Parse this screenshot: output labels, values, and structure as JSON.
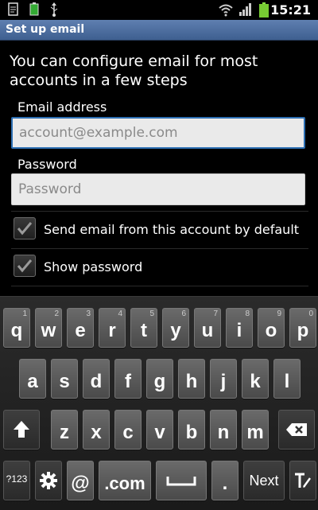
{
  "status_bar": {
    "time": "15:21",
    "left_icons": [
      "document-icon",
      "battery-saver-icon",
      "usb-icon"
    ],
    "right_icons": [
      "wifi-icon",
      "signal-icon",
      "battery-icon"
    ]
  },
  "title_bar": {
    "title": "Set up email"
  },
  "form": {
    "intro": "You can configure email for most accounts in a few steps",
    "email_label": "Email address",
    "email_placeholder": "account@example.com",
    "email_value": "",
    "password_label": "Password",
    "password_placeholder": "Password",
    "password_value": "",
    "default_checkbox_label": "Send email from this account by default",
    "default_checked": true,
    "show_password_label": "Show password",
    "show_password_checked": true
  },
  "keyboard": {
    "row1": [
      {
        "main": "q",
        "sup": "1"
      },
      {
        "main": "w",
        "sup": "2"
      },
      {
        "main": "e",
        "sup": "3"
      },
      {
        "main": "r",
        "sup": "4"
      },
      {
        "main": "t",
        "sup": "5"
      },
      {
        "main": "y",
        "sup": "6"
      },
      {
        "main": "u",
        "sup": "7"
      },
      {
        "main": "i",
        "sup": "8"
      },
      {
        "main": "o",
        "sup": "9"
      },
      {
        "main": "p",
        "sup": "0"
      }
    ],
    "row2": [
      "a",
      "s",
      "d",
      "f",
      "g",
      "h",
      "j",
      "k",
      "l"
    ],
    "row3": [
      "z",
      "x",
      "c",
      "v",
      "b",
      "n",
      "m"
    ],
    "symbols_label": "?123",
    "at_label": "@",
    "com_label": ".com",
    "period_label": ".",
    "next_label": "Next"
  },
  "colors": {
    "title_bar": "#4a6a9c",
    "focus_border": "#2d6fb3",
    "key": "#5a5a5a"
  }
}
